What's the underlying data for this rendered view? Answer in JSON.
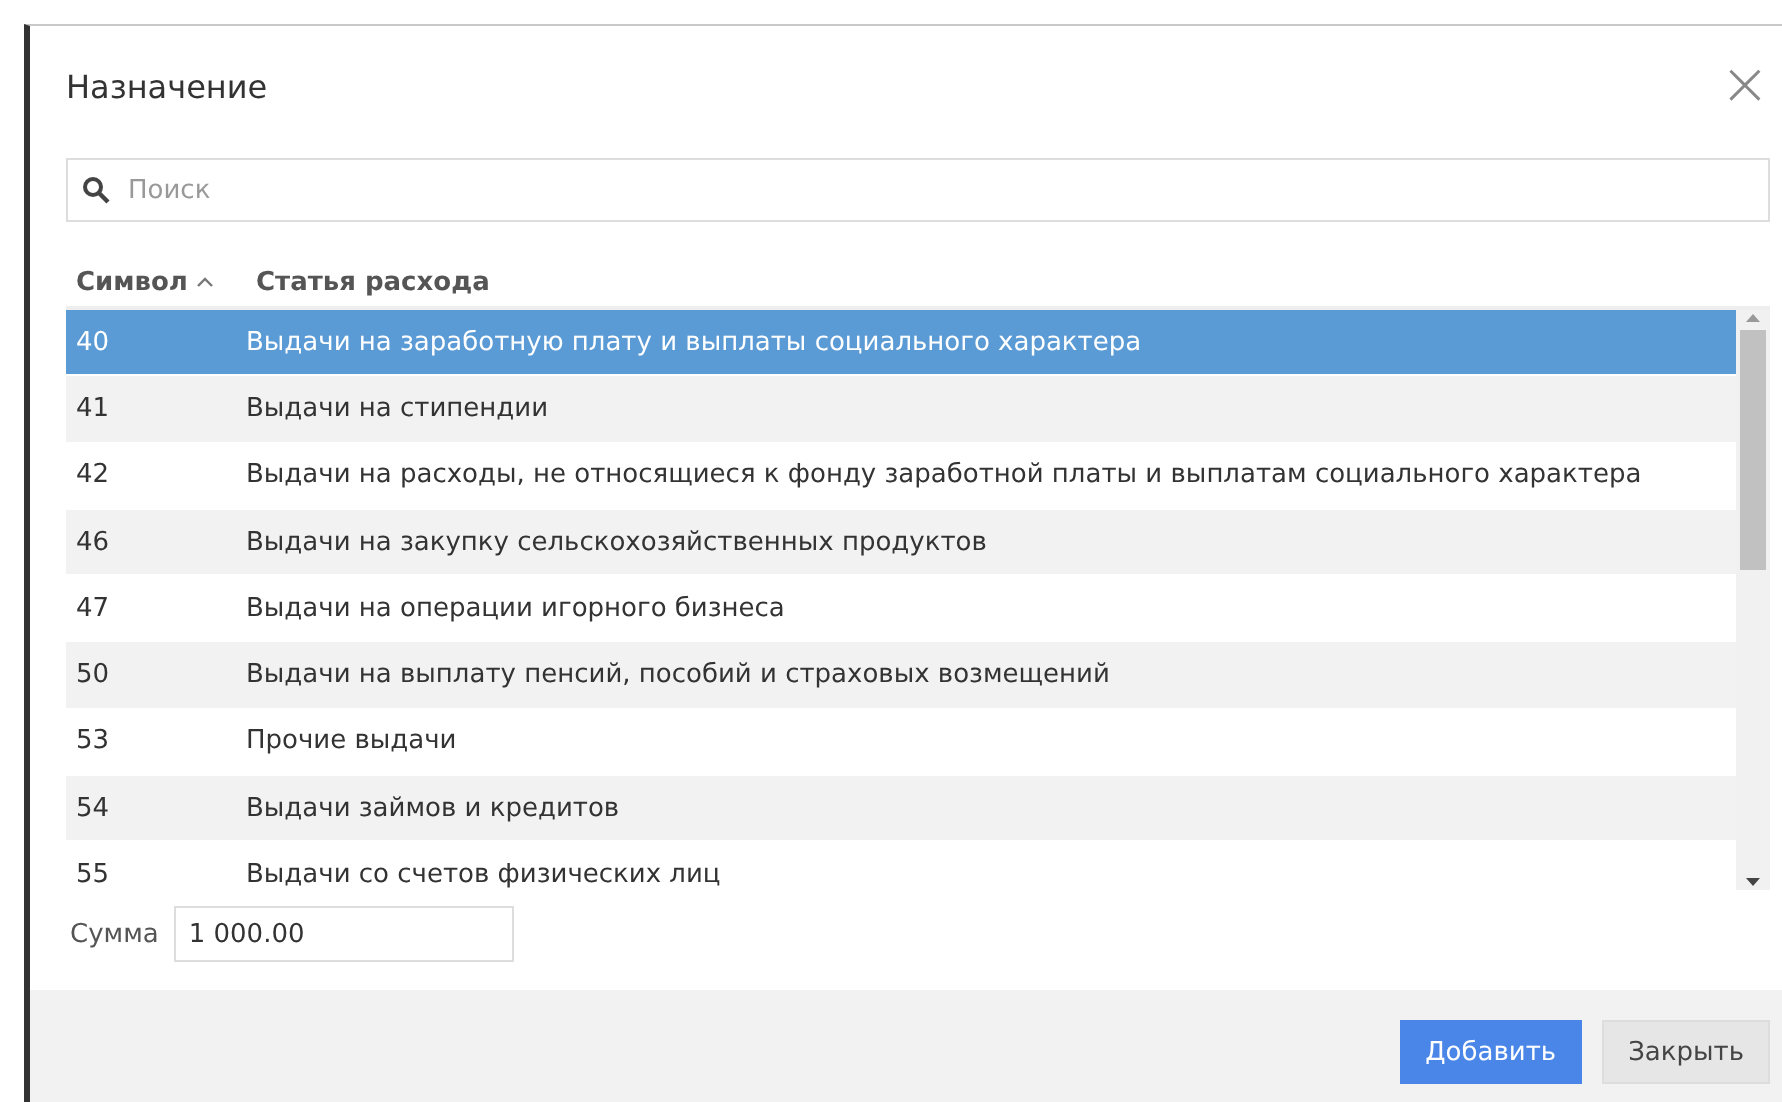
{
  "dialog": {
    "title": "Назначение",
    "close": "×"
  },
  "search": {
    "placeholder": "Поиск"
  },
  "table": {
    "columns": [
      {
        "label": "Символ",
        "sorted_ascending": true
      },
      {
        "label": "Статья расхода"
      }
    ],
    "rows": [
      {
        "symbol": "40",
        "item": "Выдачи на заработную плату и выплаты социального характера",
        "selected": true
      },
      {
        "symbol": "41",
        "item": "Выдачи на стипендии",
        "selected": false
      },
      {
        "symbol": "42",
        "item": "Выдачи на расходы, не относящиеся к фонду заработной платы и выплатам социального характера",
        "selected": false
      },
      {
        "symbol": "46",
        "item": "Выдачи на закупку сельскохозяйственных продуктов",
        "selected": false
      },
      {
        "symbol": "47",
        "item": "Выдачи на операции игорного бизнеса",
        "selected": false
      },
      {
        "symbol": "50",
        "item": "Выдачи на выплату пенсий, пособий и страховых возмещений",
        "selected": false
      },
      {
        "symbol": "53",
        "item": "Прочие выдачи",
        "selected": false
      },
      {
        "symbol": "54",
        "item": "Выдачи займов и кредитов",
        "selected": false
      },
      {
        "symbol": "55",
        "item": "Выдачи со счетов физических лиц",
        "selected": false
      }
    ]
  },
  "amount": {
    "label": "Сумма",
    "value": "1 000.00"
  },
  "buttons": [
    {
      "label": "Добавить",
      "kind": "primary"
    },
    {
      "label": "Закрыть",
      "kind": "secondary"
    }
  ]
}
